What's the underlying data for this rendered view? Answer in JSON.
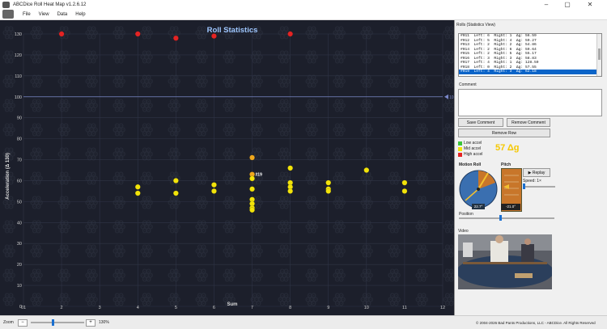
{
  "window": {
    "title": "ABCDice Roll Heat Map v1.2.6.12",
    "min": "–",
    "max": "▢",
    "close": "✕"
  },
  "menu": [
    "File",
    "View",
    "Data",
    "Help"
  ],
  "chart_data": {
    "type": "scatter",
    "title": "Roll Statistics",
    "xlabel": "Sum",
    "ylabel": "Acceleration (Δ 130)",
    "xlim": [
      1,
      12
    ],
    "ylim": [
      0,
      130
    ],
    "x_ticks": [
      "01",
      "2",
      "3",
      "4",
      "5",
      "6",
      "7",
      "8",
      "9",
      "10",
      "11",
      "12"
    ],
    "y_ticks": [
      0,
      10,
      20,
      30,
      40,
      50,
      60,
      70,
      80,
      90,
      100,
      110,
      120,
      130
    ],
    "reference_line": {
      "y": 100,
      "label": "10"
    },
    "selected_label": "#19",
    "colors": {
      "low": "#3ac43a",
      "mid": "#f2e30a",
      "high": "#e42424",
      "amber": "#f0a81e"
    },
    "points": [
      {
        "x": 2,
        "y": 130,
        "level": "high"
      },
      {
        "x": 4,
        "y": 130,
        "level": "high"
      },
      {
        "x": 5,
        "y": 128,
        "level": "high"
      },
      {
        "x": 6,
        "y": 129,
        "level": "high"
      },
      {
        "x": 8,
        "y": 130,
        "level": "high"
      },
      {
        "x": 4,
        "y": 57,
        "level": "mid"
      },
      {
        "x": 4,
        "y": 54,
        "level": "mid"
      },
      {
        "x": 5,
        "y": 60,
        "level": "mid"
      },
      {
        "x": 5,
        "y": 54,
        "level": "mid"
      },
      {
        "x": 6,
        "y": 58,
        "level": "mid"
      },
      {
        "x": 6,
        "y": 55,
        "level": "mid"
      },
      {
        "x": 7,
        "y": 71,
        "level": "amber"
      },
      {
        "x": 7,
        "y": 63,
        "level": "amber"
      },
      {
        "x": 7,
        "y": 61,
        "level": "mid"
      },
      {
        "x": 7,
        "y": 56,
        "level": "mid"
      },
      {
        "x": 7,
        "y": 51,
        "level": "mid"
      },
      {
        "x": 7,
        "y": 49,
        "level": "mid"
      },
      {
        "x": 7,
        "y": 47,
        "level": "mid"
      },
      {
        "x": 7,
        "y": 46,
        "level": "mid"
      },
      {
        "x": 8,
        "y": 66,
        "level": "mid"
      },
      {
        "x": 8,
        "y": 59,
        "level": "mid"
      },
      {
        "x": 8,
        "y": 57,
        "level": "mid"
      },
      {
        "x": 8,
        "y": 55,
        "level": "mid"
      },
      {
        "x": 9,
        "y": 59,
        "level": "mid"
      },
      {
        "x": 9,
        "y": 56,
        "level": "mid"
      },
      {
        "x": 9,
        "y": 55,
        "level": "mid"
      },
      {
        "x": 10,
        "y": 65,
        "level": "mid"
      },
      {
        "x": 11,
        "y": 59,
        "level": "mid"
      },
      {
        "x": 11,
        "y": 55,
        "level": "mid"
      }
    ]
  },
  "panel": {
    "header": "Rolls (Statistics View)",
    "rolls": [
      "#011  Left: 6  Right: 1  Δg: 56.59",
      "#012  Left: 5  Right: 4  Δg: 59.27",
      "#013  Left: 2  Right: 2  Δg: 54.86",
      "#014  Left: 2  Right: 6  Δg: 59.64",
      "#015  Left: 2  Right: 5  Δg: 55.17",
      "#016  Left: 3  Right: 3  Δg: 58.83",
      "#017  Left: 4  Right: 1  Δg: 128.59",
      "#018  Left: 0  Right: 2  Δg: 57.55",
      "#019  Left: 4  Right: 3  Δg: 62.18"
    ],
    "selected_index": 8,
    "comment_label": "Comment",
    "save_comment": "Save Comment",
    "remove_comment": "Remove Comment",
    "remove_row": "Remove Row",
    "legend": {
      "low": "Low accel",
      "mid": "Mid accel",
      "high": "High accel"
    },
    "accel_value": "57 Δg",
    "motion_roll_label": "Motion Roll",
    "pitch_label": "Pitch",
    "replay_label": "▶ Replay",
    "speed_label": "Speed: 1×",
    "roll_value": "22.7°",
    "pitch_value": "-21.0°",
    "position_label": "Position",
    "video_label": "Video"
  },
  "status": {
    "zoom_label": "Zoom",
    "minus": "−",
    "plus": "+",
    "zoom_value": "130%",
    "copyright": "© 2004-2026  Bad Pants Productions, LLC - ABCDice.  All Rights Reserved"
  }
}
